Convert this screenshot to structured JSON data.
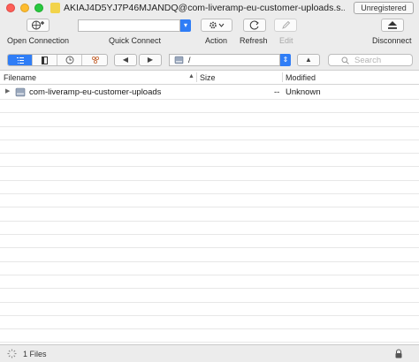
{
  "window": {
    "title": "AKIAJ4D5YJ7P46MJANDQ@com-liveramp-eu-customer-uploads.s...",
    "badge": "Unregistered"
  },
  "toolbar": {
    "open_connection": "Open Connection",
    "quick_connect": "Quick Connect",
    "action": "Action",
    "refresh": "Refresh",
    "edit": "Edit",
    "disconnect": "Disconnect"
  },
  "navigation": {
    "path": "/",
    "search_placeholder": "Search"
  },
  "table": {
    "columns": [
      "Filename",
      "Size",
      "Modified"
    ],
    "rows": [
      {
        "filename": "com-liveramp-eu-customer-uploads",
        "size": "--",
        "modified": "Unknown"
      }
    ]
  },
  "status": {
    "text": "1 Files"
  },
  "colors": {
    "accent": "#2f7df6",
    "toolbar_bg": "#ececec"
  }
}
